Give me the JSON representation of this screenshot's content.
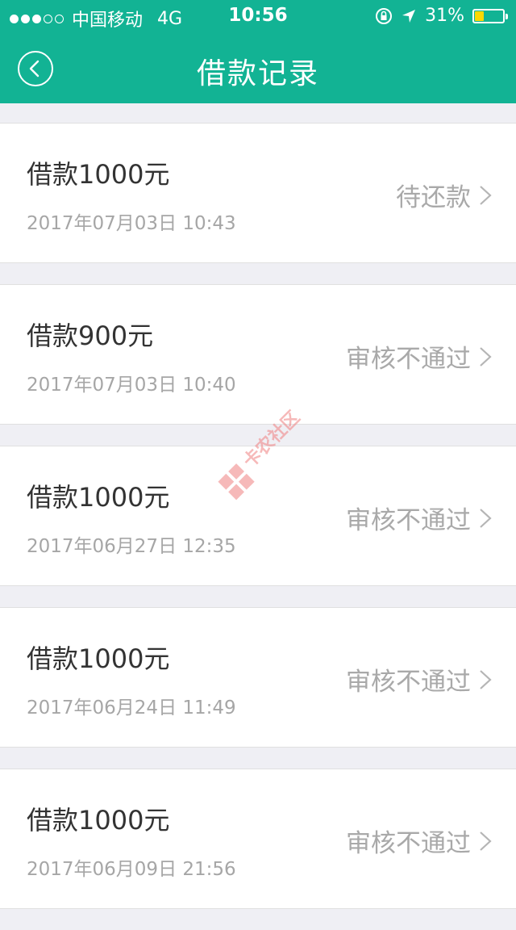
{
  "status_bar": {
    "carrier": "中国移动",
    "network": "4G",
    "time": "10:56",
    "battery": "31%",
    "battery_level": 0.31
  },
  "nav": {
    "title": "借款记录",
    "back_icon": "chevron-left-icon"
  },
  "records": [
    {
      "title": "借款1000元",
      "time": "2017年07月03日 10:43",
      "status": "待还款"
    },
    {
      "title": "借款900元",
      "time": "2017年07月03日 10:40",
      "status": "审核不通过"
    },
    {
      "title": "借款1000元",
      "time": "2017年06月27日 12:35",
      "status": "审核不通过"
    },
    {
      "title": "借款1000元",
      "time": "2017年06月24日 11:49",
      "status": "审核不通过"
    },
    {
      "title": "借款1000元",
      "time": "2017年06月09日 21:56",
      "status": "审核不通过"
    }
  ],
  "watermark": {
    "text": "卡农社区"
  },
  "colors": {
    "brand": "#12b394",
    "battery_fill": "#ffd800"
  }
}
